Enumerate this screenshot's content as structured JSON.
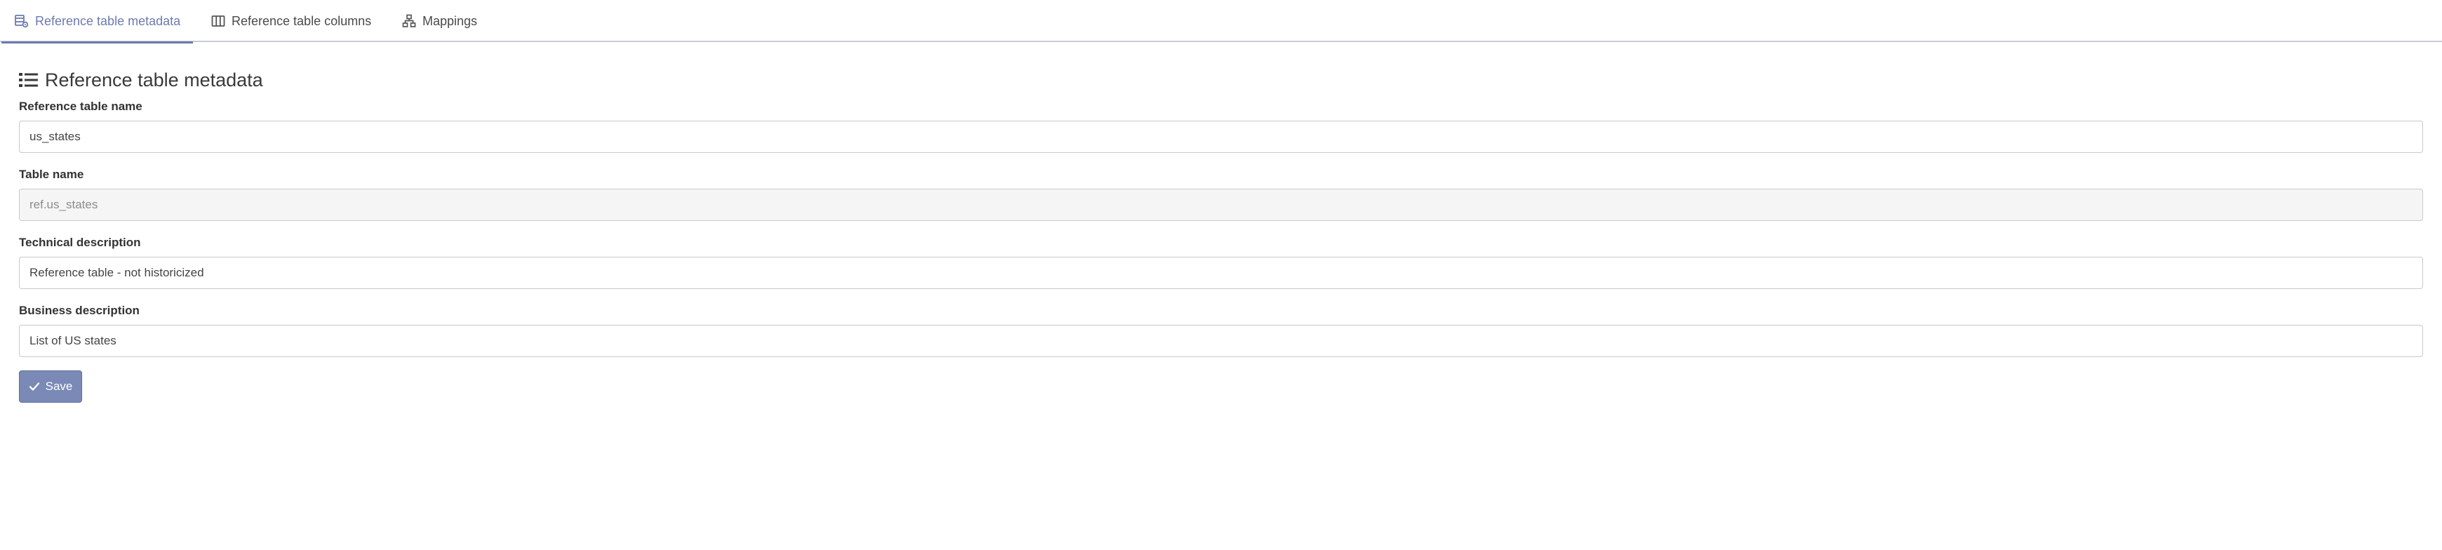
{
  "tabs": {
    "metadata": {
      "label": "Reference table metadata",
      "icon": "table-gear-icon",
      "active": true
    },
    "columns": {
      "label": "Reference table columns",
      "icon": "columns-icon",
      "active": false
    },
    "mappings": {
      "label": "Mappings",
      "icon": "sitemap-icon",
      "active": false
    }
  },
  "section": {
    "title": "Reference table metadata",
    "icon": "list-icon"
  },
  "form": {
    "reference_table_name": {
      "label": "Reference table name",
      "value": "us_states"
    },
    "table_name": {
      "label": "Table name",
      "value": "ref.us_states",
      "readonly": true
    },
    "technical_description": {
      "label": "Technical description",
      "value": "Reference table - not historicized"
    },
    "business_description": {
      "label": "Business description",
      "value": "List of US states"
    }
  },
  "actions": {
    "save_label": "Save",
    "save_icon": "check-icon"
  },
  "colors": {
    "accent": "#6c7bb0",
    "button": "#7a89b6",
    "readonly_bg": "#f5f5f5"
  }
}
